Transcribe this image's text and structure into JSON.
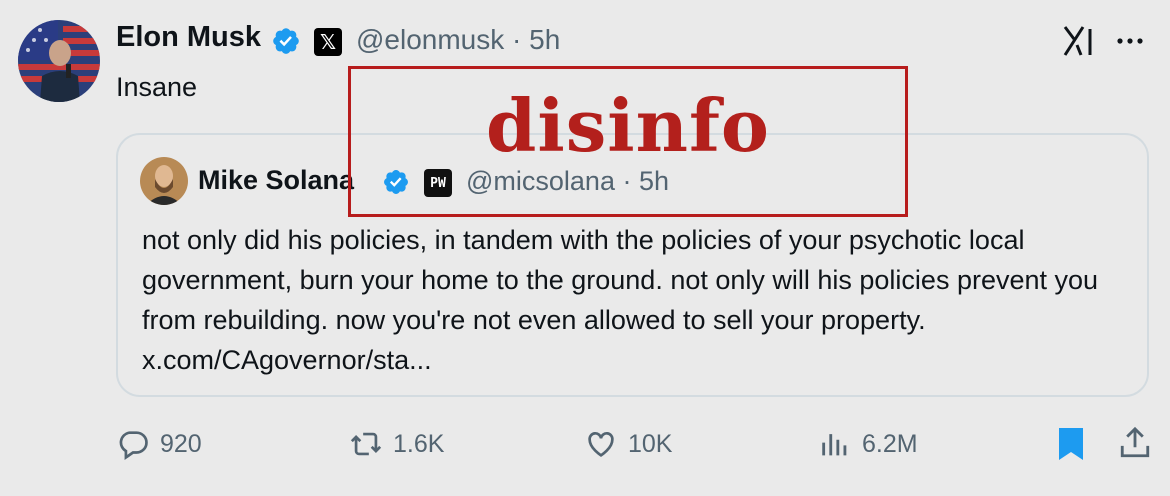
{
  "post": {
    "author_name": "Elon Musk",
    "author_handle": "@elonmusk",
    "time_sep": "·",
    "time": "5h",
    "affiliate_badge": "𝕏",
    "text": "Insane"
  },
  "quoted": {
    "author_name": "Mike Solana",
    "author_handle": "@micsolana",
    "time_sep": "·",
    "time": "5h",
    "affiliate_badge": "PW",
    "text": "not only did his policies, in tandem with the policies of your psychotic local government, burn your home to the ground. not only will his policies prevent you from rebuilding. now you're not even allowed to sell your property. x.com/CAgovernor/sta..."
  },
  "overlay": {
    "stamp_text": "disinfo",
    "color": "#b3201c"
  },
  "actions": {
    "replies": "920",
    "reposts": "1.6K",
    "likes": "10K",
    "views": "6.2M"
  },
  "colors": {
    "verified": "#1d9bf0",
    "bookmark": "#1d9bf0",
    "muted_text": "#536471",
    "background": "#eaeaea"
  },
  "icons": [
    "verified-badge-icon",
    "x-logo-icon",
    "grok-icon",
    "more-icon",
    "reply-icon",
    "repost-icon",
    "like-icon",
    "views-icon",
    "bookmark-icon",
    "share-icon"
  ]
}
